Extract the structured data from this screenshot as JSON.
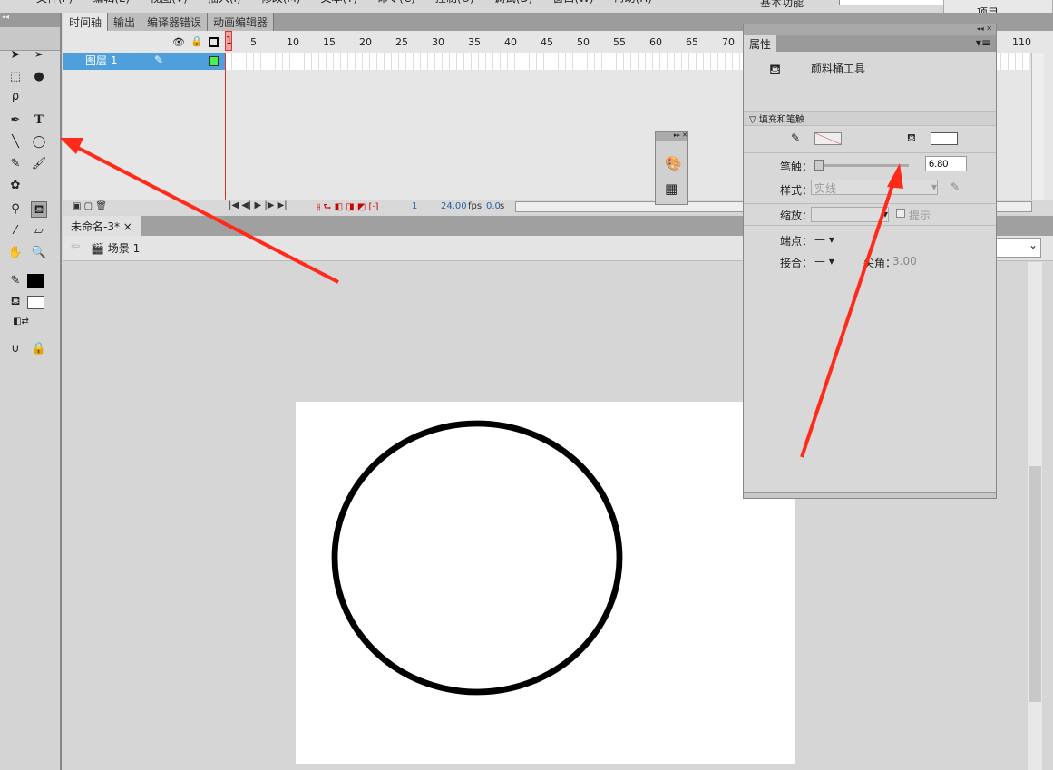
{
  "menu": [
    "文件(F)",
    "编辑(E)",
    "视图(V)",
    "插入(I)",
    "修改(M)",
    "文本(T)",
    "命令(C)",
    "控制(O)",
    "调试(D)",
    "窗口(W)",
    "帮助(H)"
  ],
  "workspace": "基本功能",
  "project_label": "项目",
  "timeline_tabs": [
    "时间轴",
    "输出",
    "编译器错误",
    "动画编辑器"
  ],
  "frame_numbers": [
    "1",
    "5",
    "10",
    "15",
    "20",
    "25",
    "30",
    "35",
    "40",
    "45",
    "50",
    "55",
    "60",
    "65",
    "70",
    "110"
  ],
  "layer": {
    "name": "图层 1"
  },
  "timeline_status": {
    "frame": "1",
    "fps": "24.00",
    "fps_unit": "fps",
    "time": "0.0",
    "time_unit": "s"
  },
  "document_tab": "未命名-3*",
  "scene": "场景 1",
  "properties": {
    "tab": "属性",
    "tool_name": "颜料桶工具",
    "section": "填充和笔触",
    "stroke_label": "笔触：",
    "stroke_value": "6.80",
    "stroke_slider_fraction": 0.06,
    "style_label": "样式：",
    "style_value": "实线",
    "scale_label": "缩放：",
    "hint_label": "提示",
    "cap_label": "端点：",
    "join_label": "接合：",
    "miter_label": "尖角：",
    "miter_value": "3.00"
  },
  "colors": {
    "accent": "#4e9fdb",
    "stroke": "#000000",
    "fill": "#ffffff",
    "arrow": "#ff2a1a"
  }
}
